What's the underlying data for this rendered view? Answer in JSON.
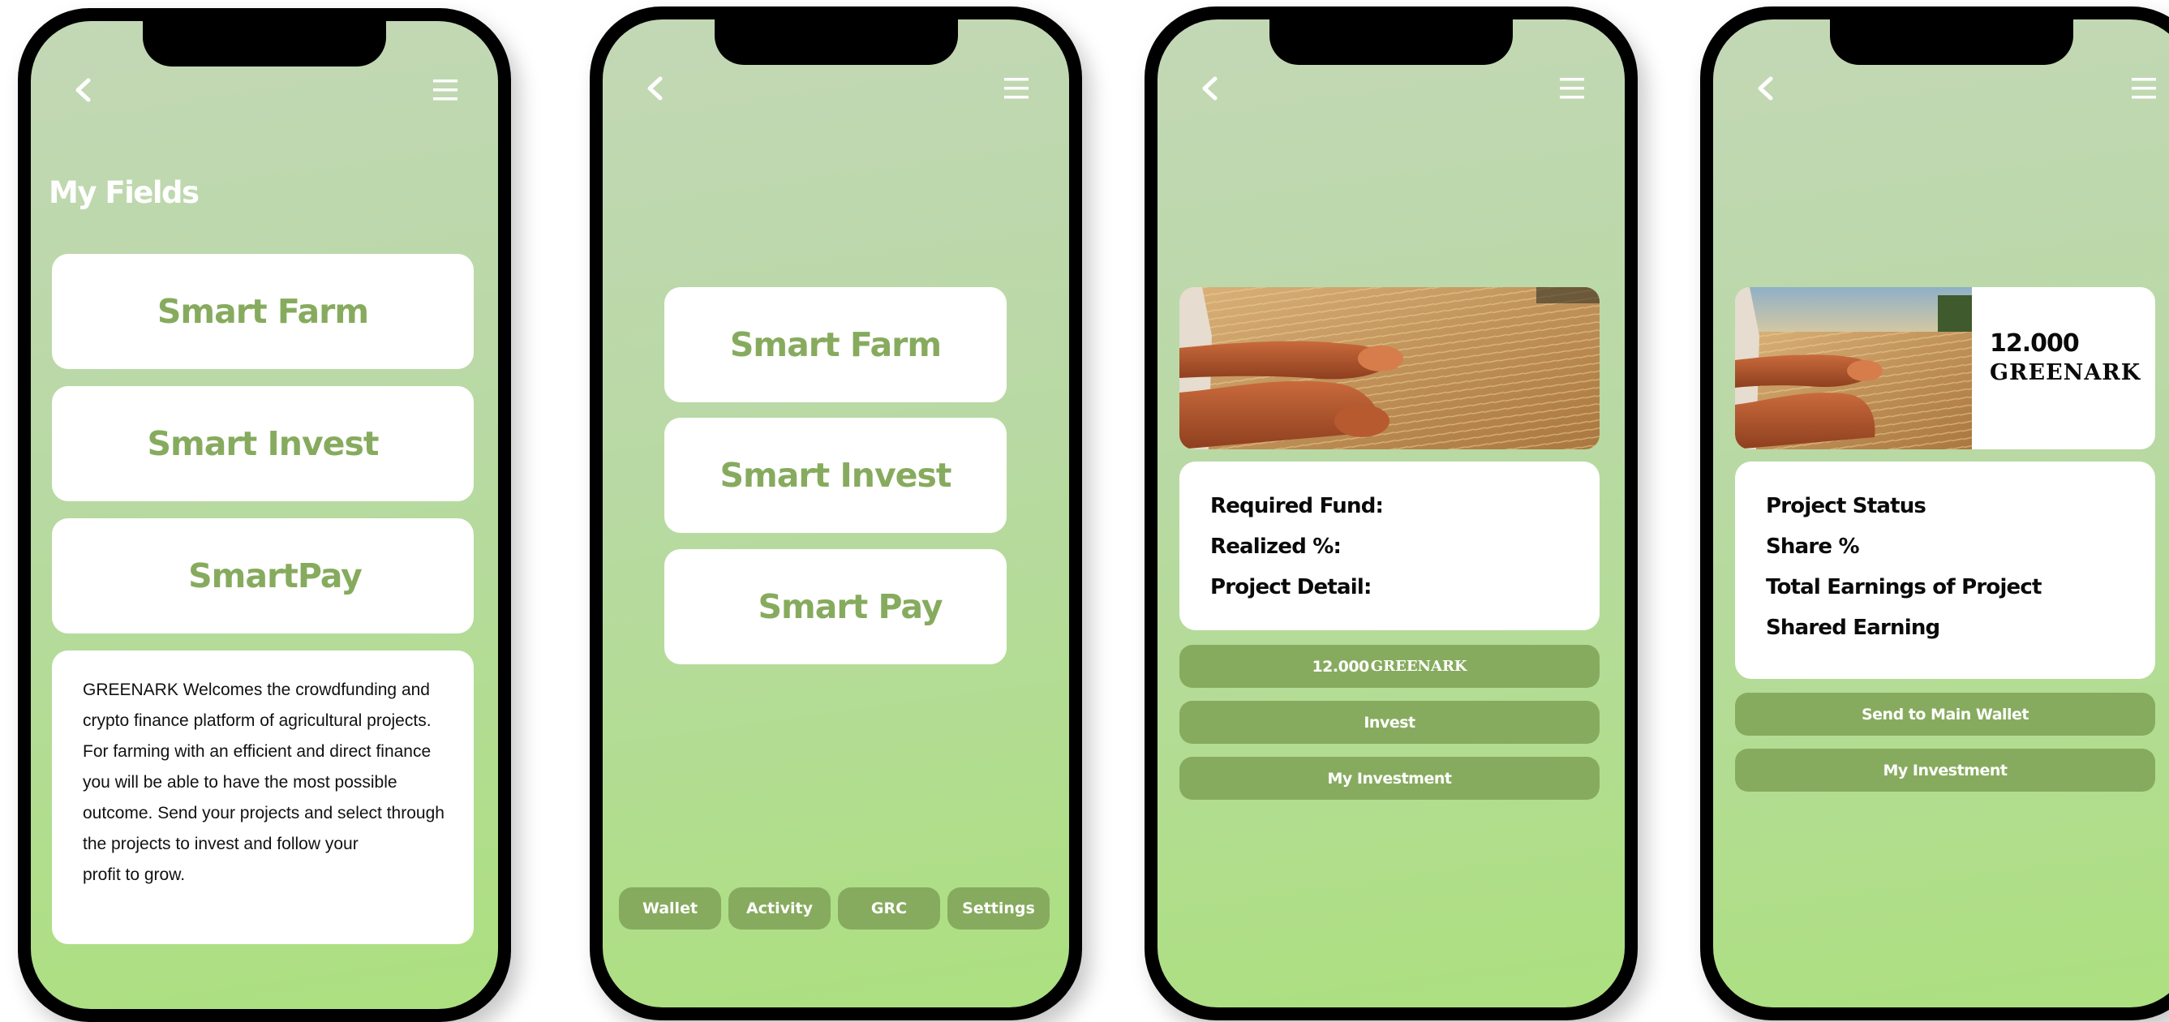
{
  "phone1": {
    "title": "My Fields",
    "cards": [
      "Smart Farm",
      "Smart Invest",
      "SmartPay"
    ],
    "welcome": "GREENARK Welcomes the crowdfunding and\ncrypto finance platform of agricultural projects.\nFor farming with an efficient and direct finance\nyou will be able to have the most possible\noutcome. Send your projects and select through\nthe projects to invest and follow your\nprofit to grow."
  },
  "phone2": {
    "cards": [
      "Smart Farm",
      "Smart Invest",
      "Smart Pay"
    ],
    "tabs": [
      "Wallet",
      "Activity",
      "GRC",
      "Settings"
    ]
  },
  "phone3": {
    "details": [
      "Required Fund:",
      "Realized %:",
      "Project Detail:"
    ],
    "amount_number": "12.000",
    "amount_unit": "GREENARK",
    "invest_label": "Invest",
    "my_investment_label": "My Investment"
  },
  "phone4": {
    "balance_number": "12.000",
    "balance_unit": "GREENARK",
    "details": [
      "Project Status",
      "Share %",
      "Total Earnings of Project",
      "Shared Earning"
    ],
    "send_label": "Send to Main Wallet",
    "my_investment_label": "My Investment"
  },
  "colors": {
    "accent": "#87ab5e",
    "gradient_top": "#c3d8b6",
    "gradient_bottom": "#ace07f",
    "frame": "#000000"
  },
  "icons": [
    "back-icon",
    "menu-icon",
    "field-photo"
  ]
}
